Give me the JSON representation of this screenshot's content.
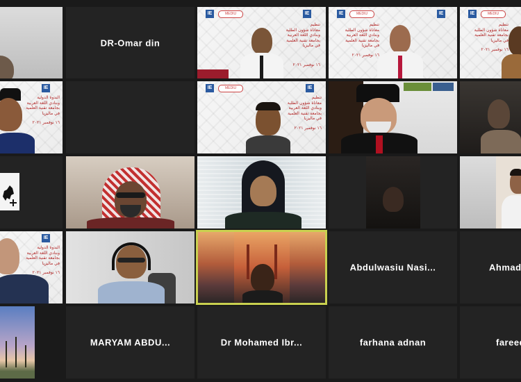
{
  "participants": {
    "dr_omar": "DR-Omar din",
    "abdulwasiu": "Abdulwasiu  Nasi...",
    "ahmad": "Ahmad I",
    "maryam": "MARYAM  ABDU...",
    "dr_mohamed": "Dr  Mohamed  Ibr...",
    "farhana": "farhana adnan",
    "fareed": "fareed"
  },
  "slide": {
    "line1": "الندوة الدولية",
    "line2": "تنظيم",
    "line3": "معاناة شؤون الطلبة",
    "line4": "وبنادي اللغة العربية",
    "line5": "بجامعة تقنية العلمية",
    "line6": "في ماليزيا",
    "date": "١٦ نوفمبر ٢٠٢١",
    "logo_text": "IE",
    "brand_text": "MEDIU"
  },
  "colors": {
    "background": "#1a1a1a",
    "tile": "#232323",
    "active_border": "#c9d04f",
    "name_text": "#ffffff"
  }
}
